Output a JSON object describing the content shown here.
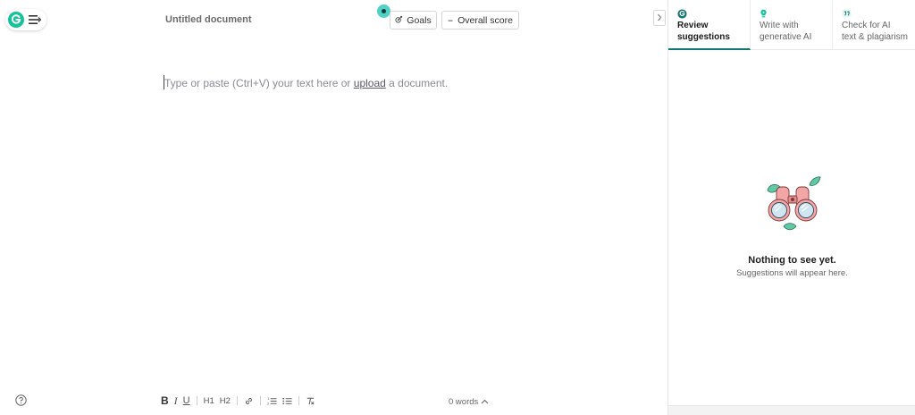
{
  "document": {
    "title": "Untitled document"
  },
  "header": {
    "goals_label": "Goals",
    "score_value": "--",
    "score_label": "Overall score"
  },
  "editor": {
    "placeholder_before": "Type or paste (Ctrl+V) your text here or ",
    "placeholder_link": "upload",
    "placeholder_after": " a document."
  },
  "toolbar": {
    "bold": "B",
    "italic": "I",
    "underline": "U",
    "h1": "H1",
    "h2": "H2"
  },
  "footer": {
    "word_count": "0 words"
  },
  "panel": {
    "tabs": [
      {
        "label_line1": "Review",
        "label_line2": "suggestions",
        "active": true,
        "icon": "grammarly-logo-icon"
      },
      {
        "label_line1": "Write with",
        "label_line2": "generative AI",
        "active": false,
        "icon": "bulb-icon"
      },
      {
        "label_line1": "Check for AI",
        "label_line2": "text & plagiarism",
        "active": false,
        "icon": "quote-icon"
      }
    ],
    "empty_title": "Nothing to see yet.",
    "empty_subtitle": "Suggestions will appear here."
  },
  "colors": {
    "brand": "#15c39a",
    "accent_dark": "#0f766e",
    "status_dot": "#4fd1c5"
  }
}
